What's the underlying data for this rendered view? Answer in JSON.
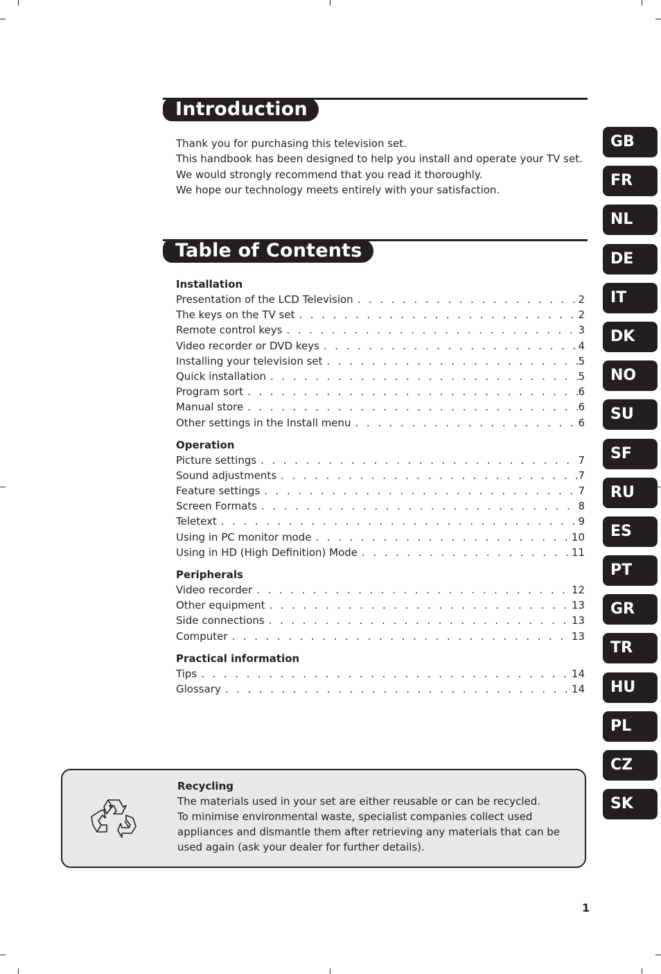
{
  "introduction": {
    "heading": "Introduction",
    "lines": [
      "Thank you for purchasing this television set.",
      "This handbook has been designed to help you install and operate your TV set.",
      "We would strongly recommend that you read it thoroughly.",
      "We hope our technology meets entirely with your satisfaction."
    ]
  },
  "toc": {
    "heading": "Table of Contents",
    "groups": [
      {
        "title": "Installation",
        "items": [
          {
            "label": "Presentation of the LCD Television",
            "page": "2"
          },
          {
            "label": "The keys on the TV set",
            "page": "2"
          },
          {
            "label": "Remote control keys",
            "page": "3"
          },
          {
            "label": "Video recorder or DVD keys",
            "page": "4"
          },
          {
            "label": "Installing your television set",
            "page": "5"
          },
          {
            "label": "Quick installation",
            "page": "5"
          },
          {
            "label": "Program sort",
            "page": "6"
          },
          {
            "label": "Manual store",
            "page": "6"
          },
          {
            "label": "Other settings in the Install menu",
            "page": "6"
          }
        ]
      },
      {
        "title": "Operation",
        "items": [
          {
            "label": "Picture settings",
            "page": "7"
          },
          {
            "label": "Sound adjustments",
            "page": "7"
          },
          {
            "label": "Feature settings",
            "page": "7"
          },
          {
            "label": "Screen Formats",
            "page": "8"
          },
          {
            "label": "Teletext",
            "page": "9"
          },
          {
            "label": "Using in PC monitor mode",
            "page": "10"
          },
          {
            "label": "Using in HD (High Definition) Mode",
            "page": "11"
          }
        ]
      },
      {
        "title": "Peripherals",
        "items": [
          {
            "label": "Video recorder",
            "page": "12"
          },
          {
            "label": "Other equipment",
            "page": "13"
          },
          {
            "label": "Side connections",
            "page": "13"
          },
          {
            "label": "Computer",
            "page": "13"
          }
        ]
      },
      {
        "title": "Practical information",
        "items": [
          {
            "label": "Tips",
            "page": "14"
          },
          {
            "label": "Glossary",
            "page": "14"
          }
        ]
      }
    ]
  },
  "languages": [
    "GB",
    "FR",
    "NL",
    "DE",
    "IT",
    "DK",
    "NO",
    "SU",
    "SF",
    "RU",
    "ES",
    "PT",
    "GR",
    "TR",
    "HU",
    "PL",
    "CZ",
    "SK"
  ],
  "recycling": {
    "icon": "recycle-icon",
    "title": "Recycling",
    "lines": [
      "The materials used in your set are either reusable or can be recycled.",
      "To minimise environmental waste, specialist companies collect used appliances and dismantle them after retrieving any materials that can be used again (ask your dealer for further details)."
    ]
  },
  "page_number": "1",
  "colors": {
    "ink": "#231f20",
    "box_fill": "#e8e8e8"
  }
}
